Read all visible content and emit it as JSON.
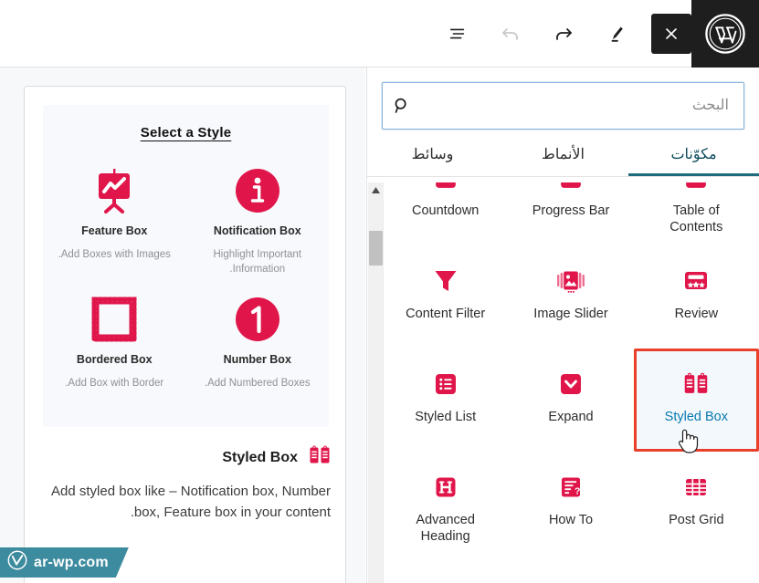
{
  "toolbar": {
    "list_view_label": "List view",
    "undo_label": "Undo",
    "redo_label": "Redo",
    "edit_label": "Edit",
    "close_label": "×",
    "wp_logo_label": "W"
  },
  "editor": {
    "style_panel": {
      "title": "Select a Style",
      "styles": [
        {
          "name": "Feature Box",
          "desc": "Add Boxes with Images.",
          "icon": "feature-box-icon"
        },
        {
          "name": "Notification Box",
          "desc": "Highlight Important Information.",
          "icon": "notification-box-icon"
        },
        {
          "name": "Bordered Box",
          "desc": "Add Box with Border.",
          "icon": "bordered-box-icon"
        },
        {
          "name": "Number Box",
          "desc": "Add Numbered Boxes.",
          "icon": "number-box-icon"
        }
      ]
    },
    "block_footer": {
      "title": "Styled Box",
      "desc": "Add styled box like – Notification box, Number box, Feature box in your content."
    }
  },
  "watermark": {
    "text": "ar-wp.com"
  },
  "inserter": {
    "search": {
      "placeholder": "البحث",
      "value": ""
    },
    "tabs": [
      {
        "label": "مكوّنات",
        "active": true
      },
      {
        "label": "الأنماط",
        "active": false
      },
      {
        "label": "وسائط",
        "active": false
      }
    ],
    "blocks": [
      {
        "label": "Table of Contents",
        "icon": "table-of-contents-icon",
        "selected": false
      },
      {
        "label": "Progress Bar",
        "icon": "progress-bar-icon",
        "selected": false
      },
      {
        "label": "Countdown",
        "icon": "countdown-icon",
        "selected": false
      },
      {
        "label": "Review",
        "icon": "review-icon",
        "selected": false
      },
      {
        "label": "Image Slider",
        "icon": "image-slider-icon",
        "selected": false
      },
      {
        "label": "Content Filter",
        "icon": "content-filter-icon",
        "selected": false
      },
      {
        "label": "Styled Box",
        "icon": "styled-box-icon",
        "selected": true
      },
      {
        "label": "Expand",
        "icon": "expand-icon",
        "selected": false
      },
      {
        "label": "Styled List",
        "icon": "styled-list-icon",
        "selected": false
      },
      {
        "label": "Post Grid",
        "icon": "post-grid-icon",
        "selected": false
      },
      {
        "label": "How To",
        "icon": "how-to-icon",
        "selected": false
      },
      {
        "label": "Advanced Heading",
        "icon": "advanced-heading-icon",
        "selected": false
      }
    ]
  },
  "colors": {
    "brand_red": "#e0164b",
    "selection_border": "#e8402a",
    "tab_active": "#1e6b7d",
    "link_blue": "#0a79af",
    "watermark_bg": "#3d8b9e",
    "dark": "#1e1e1e"
  }
}
